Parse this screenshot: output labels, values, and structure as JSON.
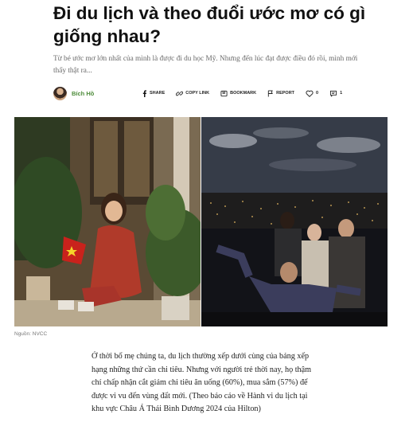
{
  "article": {
    "title": "Đi du lịch và theo đuổi ước mơ có gì giống nhau?",
    "sapo": "Từ bé ước mơ lớn nhất của mình là được đi du học Mỹ. Nhưng đến lúc đạt được điều đó rồi, mình mới thấy thật ra...",
    "author": "Bích Hồ",
    "actions": {
      "share": "SHARE",
      "copy_link": "COPY LINK",
      "bookmark": "BOOKMARK",
      "report": "REPORT",
      "like_count": "0",
      "comment_count": "1"
    },
    "photo_caption": "Nguồn: NVCC",
    "body": "Ở thời bố mẹ chúng ta, du lịch thường xếp dưới cùng của bảng xếp hạng những thứ cần chi tiêu. Nhưng với người trẻ thời nay, họ thậm chí chấp nhận cắt giảm chi tiêu ăn uống (60%), mua sắm (57%) để được vi vu đến vùng đất mới. (Theo báo cáo về Hành vi du lịch tại khu vực Châu Á Thái Bình Dương 2024 của Hilton)"
  },
  "colors": {
    "author": "#4d8c3a",
    "text": "#1a1a1a",
    "muted": "#6a6a6a"
  }
}
